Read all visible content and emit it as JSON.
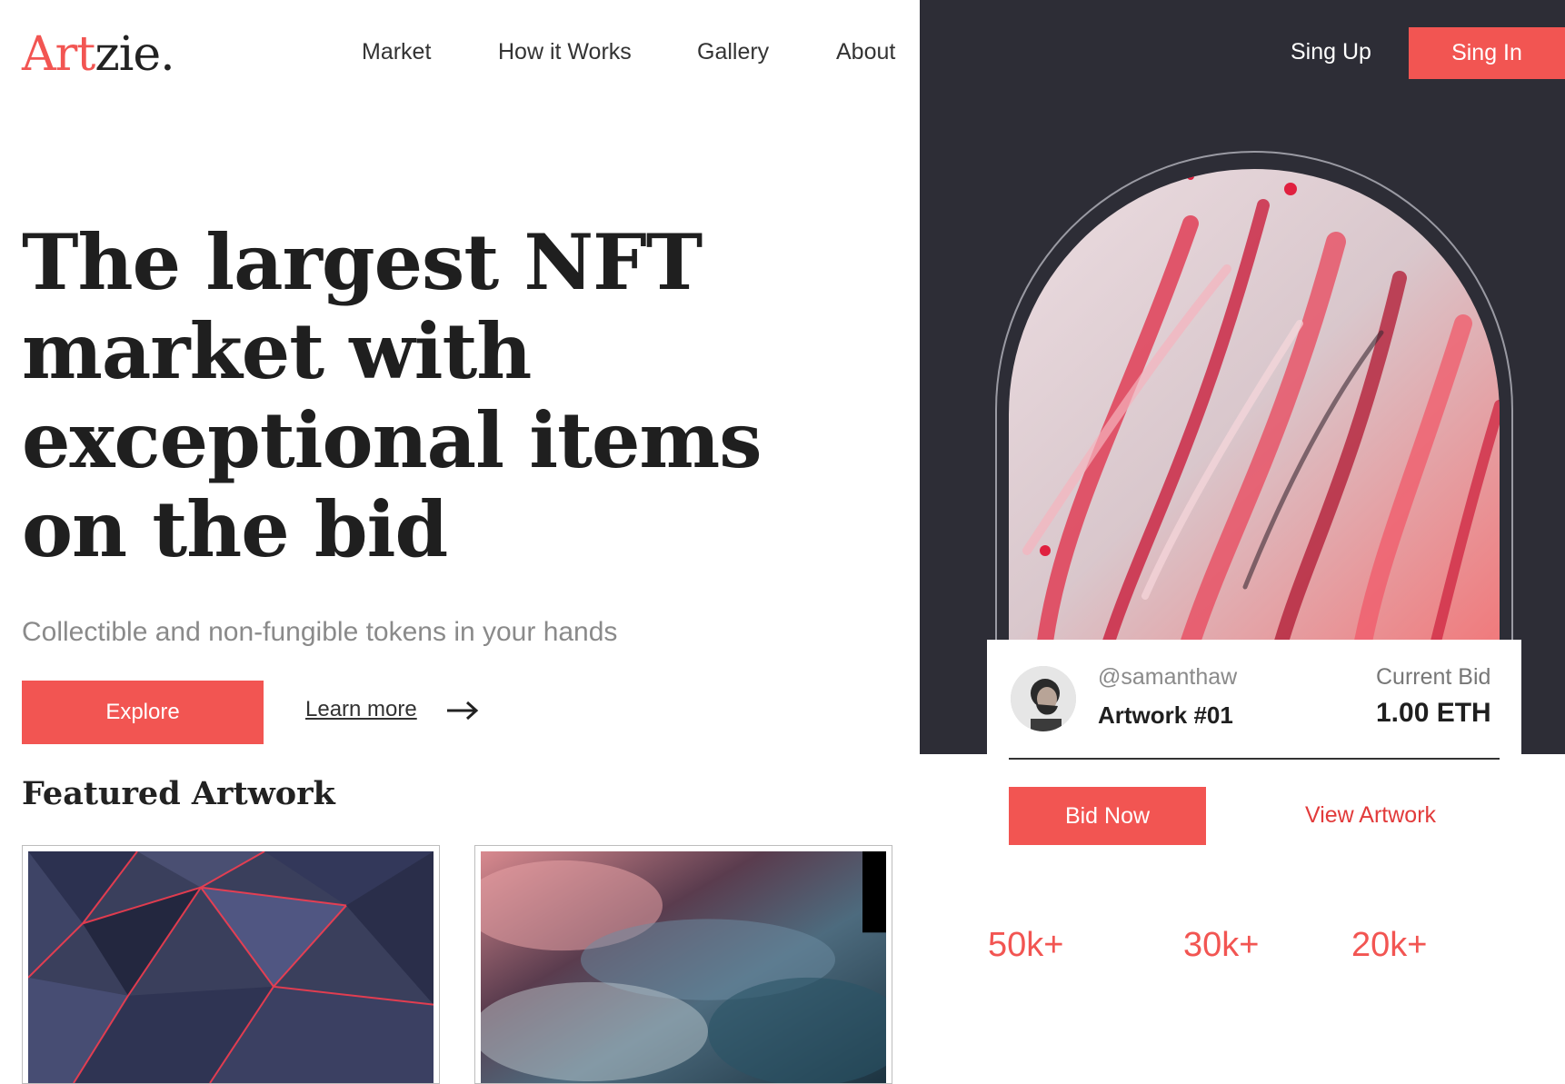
{
  "brand": {
    "name_part1": "Art",
    "name_part2": "zie.",
    "accent_color": "#f25552"
  },
  "nav": {
    "market": "Market",
    "how_it_works": "How it Works",
    "gallery": "Gallery",
    "about": "About"
  },
  "auth": {
    "sign_up": "Sing Up",
    "sign_in": "Sing In"
  },
  "hero": {
    "title": "The largest NFT market with exceptional items on the bid",
    "subtitle": "Collectible and non-fungible tokens in your hands",
    "explore_label": "Explore",
    "learn_more_label": "Learn more"
  },
  "featured": {
    "title": "Featured Artwork"
  },
  "bid_card": {
    "username": "@samanthaw",
    "artwork_name": "Artwork #01",
    "current_bid_label": "Current Bid",
    "current_bid_value": "1.00 ETH",
    "bid_now_label": "Bid Now",
    "view_artwork_label": "View Artwork"
  },
  "stats": [
    "50k+",
    "30k+",
    "20k+"
  ],
  "icons": {
    "arrow": "arrow-right-icon"
  },
  "colors": {
    "dark_panel": "#2d2d36",
    "accent": "#f25552"
  }
}
